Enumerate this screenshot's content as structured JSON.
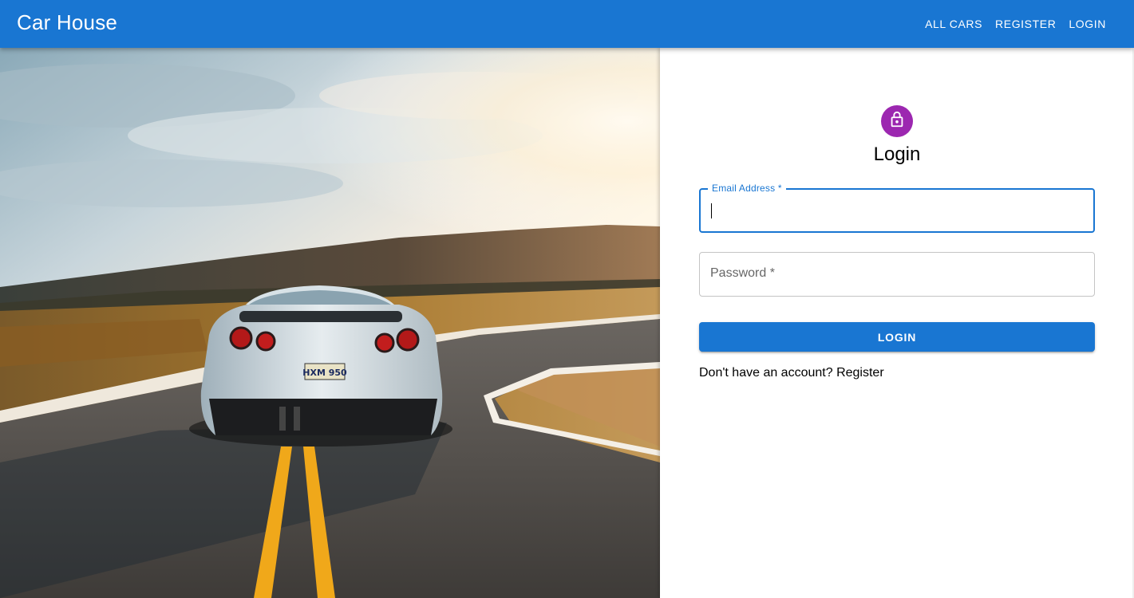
{
  "appbar": {
    "brand": "Car House",
    "nav": [
      "ALL CARS",
      "REGISTER",
      "LOGIN"
    ]
  },
  "hero": {
    "plate": "HXM 950"
  },
  "login": {
    "title": "Login",
    "email_label": "Email Address *",
    "email_value": "",
    "password_label": "Password *",
    "button": "LOGIN",
    "register_prompt": "Don't have an account? Register"
  },
  "colors": {
    "primary": "#1976d2",
    "avatar": "#9c27b0"
  },
  "icons": {
    "avatar": "lock-icon"
  }
}
